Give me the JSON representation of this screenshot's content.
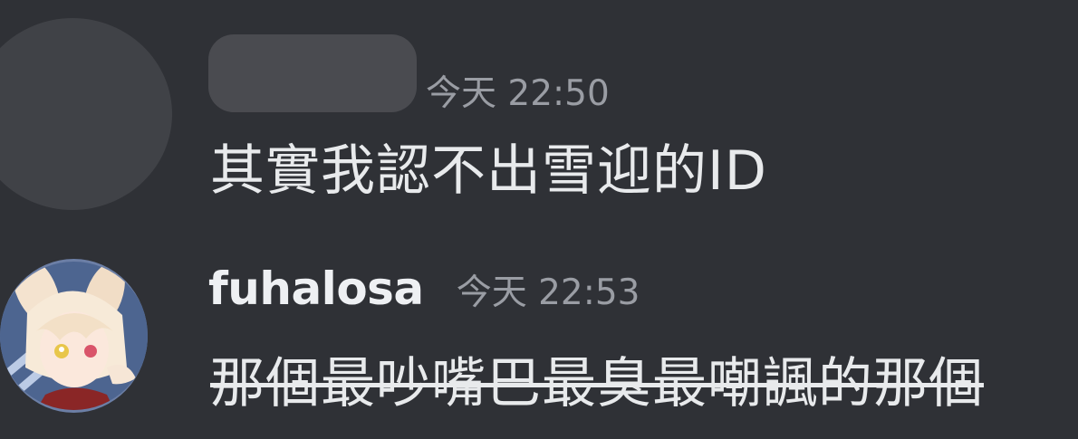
{
  "messages": [
    {
      "author": "",
      "author_hidden": true,
      "timestamp": "今天 22:50",
      "content": "其實我認不出雪迎的ID",
      "strikethrough": false
    },
    {
      "author": "fuhalosa",
      "author_hidden": false,
      "timestamp": "今天 22:53",
      "content": "那個最吵嘴巴最臭最嘲諷的那個",
      "strikethrough": true
    }
  ],
  "colors": {
    "background": "#2f3136",
    "text": "#e8eaec",
    "timestamp": "#9a9da4",
    "redaction": "#4a4b50"
  }
}
